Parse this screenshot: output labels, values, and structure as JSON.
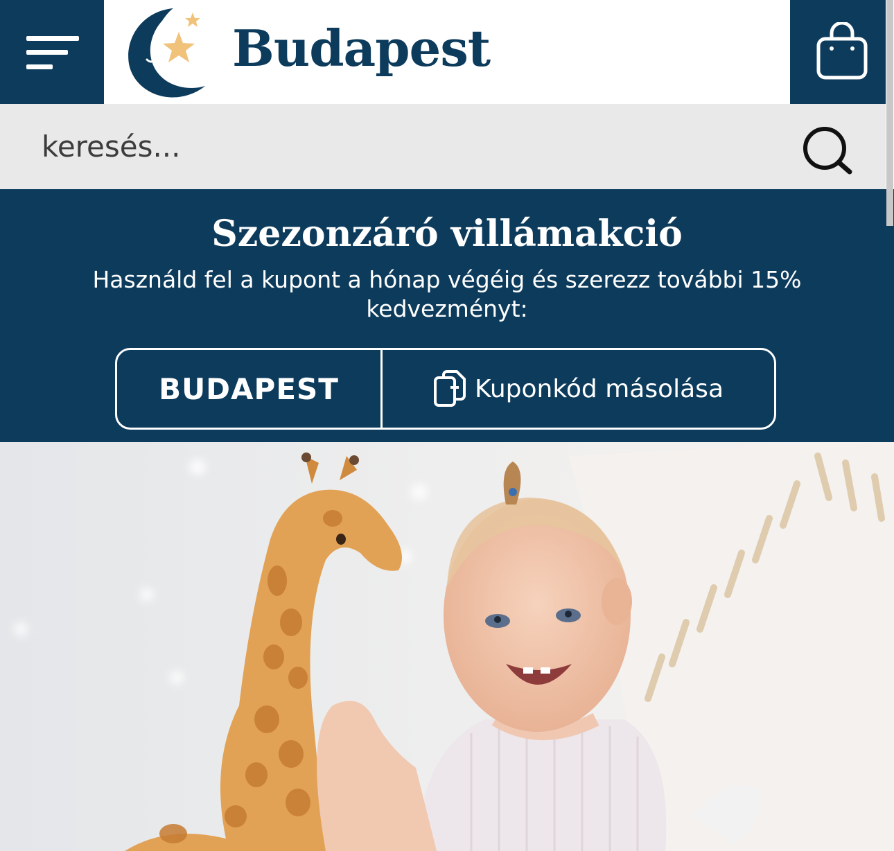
{
  "header": {
    "brand": "Budapest",
    "menu_icon": "hamburger-menu-icon",
    "logo_icon": "moon-stars-logo-icon",
    "cart_icon": "shopping-bag-icon"
  },
  "search": {
    "placeholder": "keresés...",
    "icon": "search-icon"
  },
  "promo": {
    "title": "Szezonzáró villámakció",
    "text": "Használd fel a kupont a hónap végéig és szerezz további 15% kedvezményt:",
    "coupon_code": "BUDAPEST",
    "copy_label": "Kuponkód másolása",
    "copy_icon": "copy-icon"
  },
  "hero": {
    "image": "hero-photo"
  },
  "colors": {
    "brand_navy": "#0d3b5c",
    "accent_star": "#f0c27a",
    "search_bg": "#e9e9e9"
  }
}
